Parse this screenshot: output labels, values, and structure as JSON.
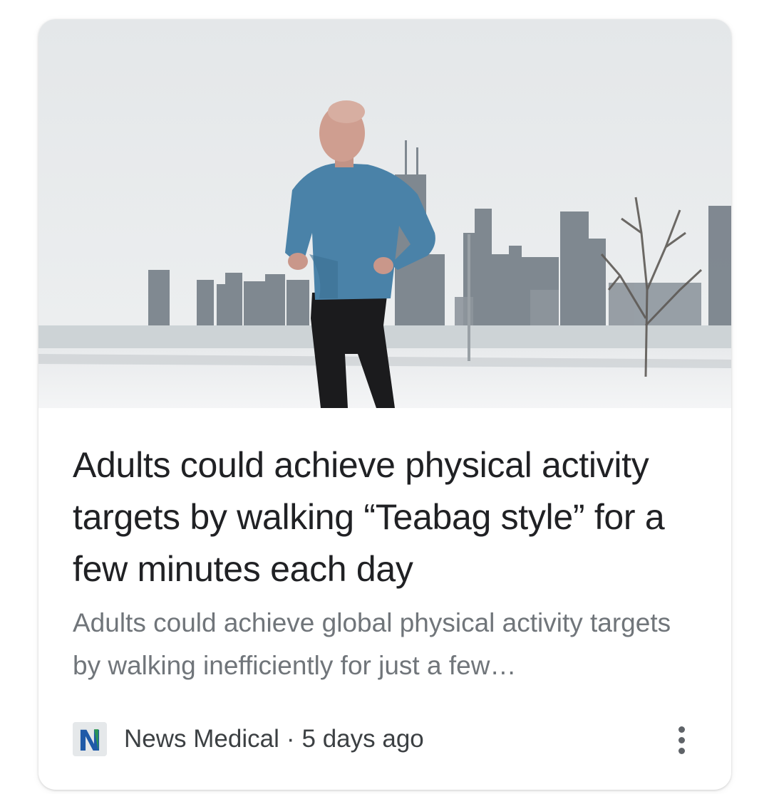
{
  "article": {
    "image_alt": "Man in blue long-sleeve shirt jogging along a snowy lakefront with a city skyline behind him",
    "headline": "Adults could achieve physical activity targets by walking “Teabag style” for a few minutes each day",
    "snippet": "Adults could achieve global physical activity targets by walking inefficiently for just a few…",
    "source": "News Medical",
    "separator": "·",
    "time_ago": "5 days ago",
    "favicon_letter": "N"
  },
  "icons": {
    "favicon": "news-medical-logo-icon",
    "more": "more-vert-icon"
  },
  "colors": {
    "headline": "#202124",
    "snippet": "#70757a",
    "source": "#3c4043",
    "favicon_blue": "#1f5aa8",
    "favicon_green": "#2e9d4a",
    "shirt": "#4a82a8"
  }
}
